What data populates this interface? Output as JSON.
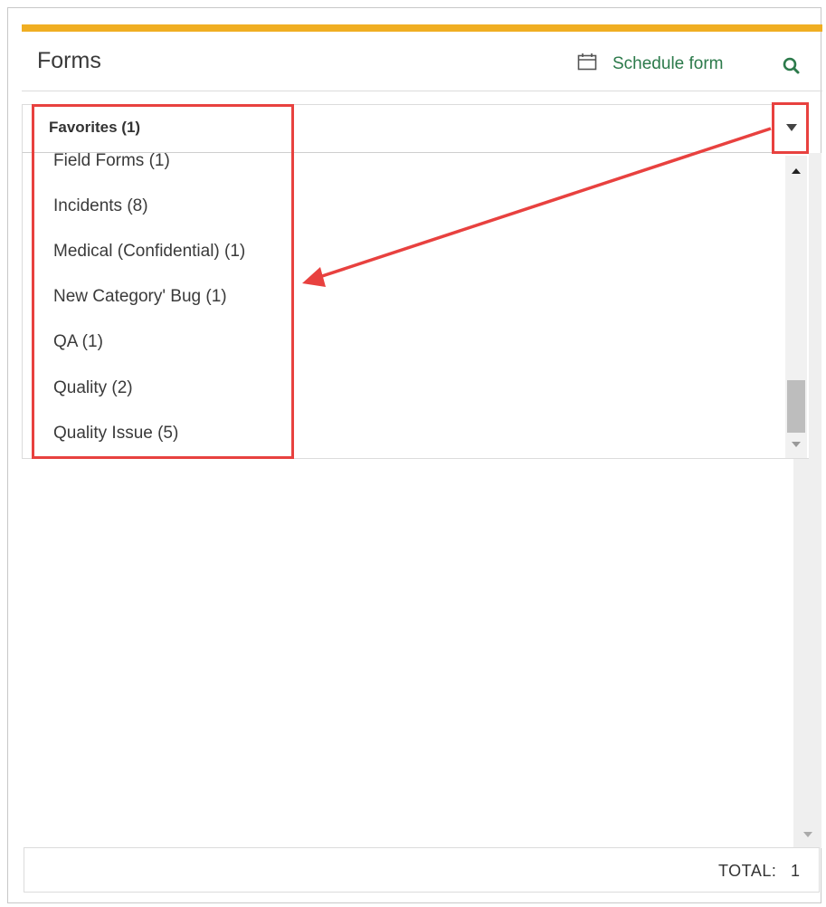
{
  "header": {
    "title": "Forms",
    "schedule_label": "Schedule form",
    "schedule_icon": "calendar-icon",
    "search_icon": "search-icon",
    "accent_color": "#f0ae22",
    "link_color": "#2c7a4b"
  },
  "filter": {
    "selected": "Favorites (1)",
    "toggle_icon": "caret-down-icon"
  },
  "categories": [
    "Field Forms (1)",
    "Incidents (8)",
    "Medical (Confidential) (1)",
    "New Category' Bug (1)",
    "QA (1)",
    "Quality (2)",
    "Quality Issue (5)"
  ],
  "footer": {
    "total_label": "TOTAL:",
    "total_value": "1"
  },
  "annotation_color": "#e8413f"
}
